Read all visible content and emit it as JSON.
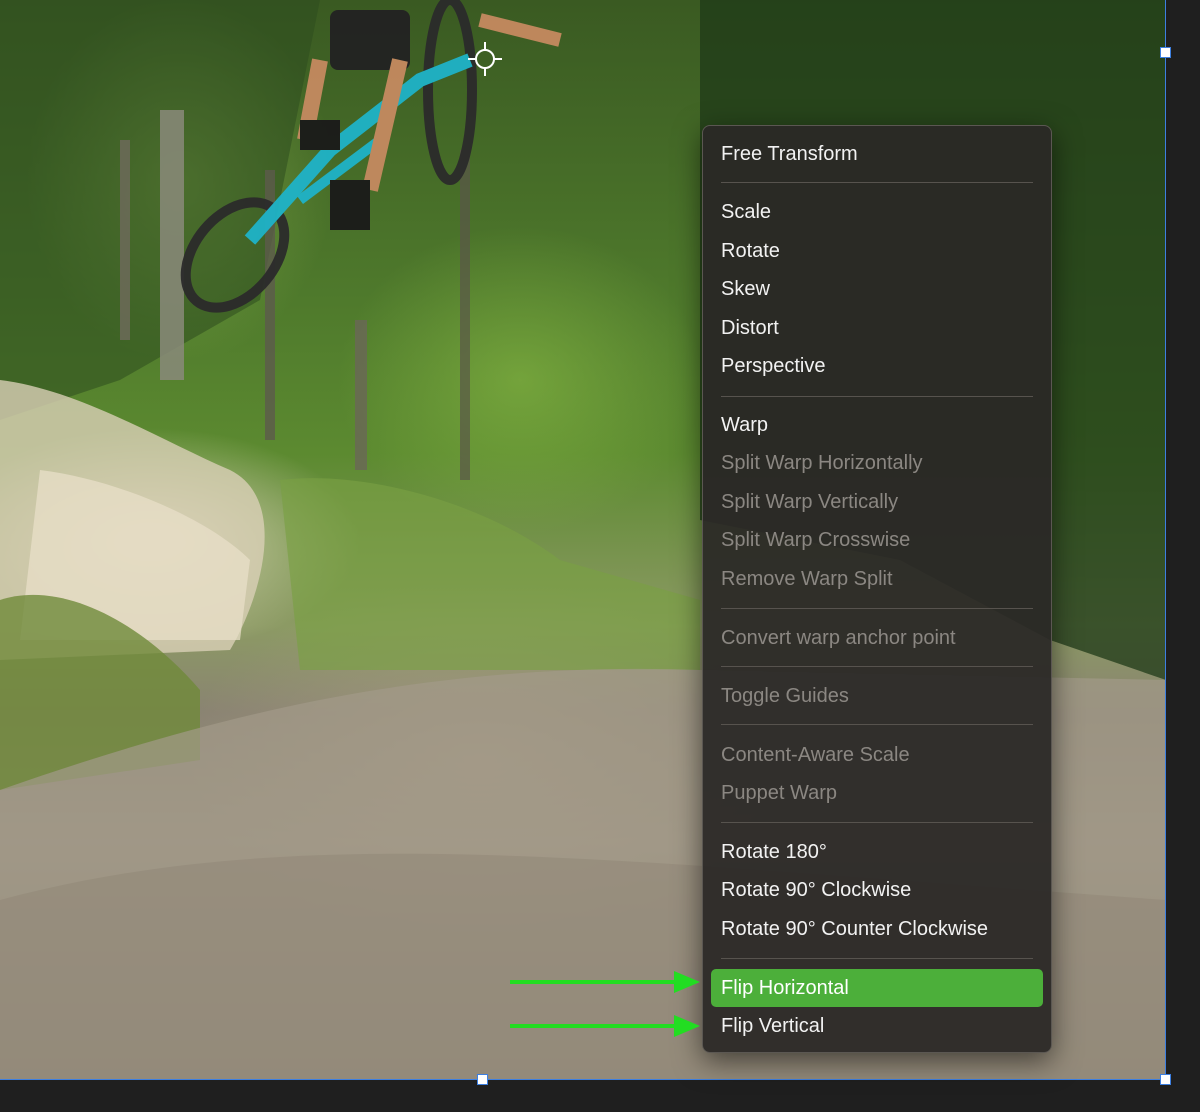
{
  "menu": {
    "items": [
      {
        "label": "Free Transform",
        "enabled": true
      },
      {
        "label": "Scale",
        "enabled": true
      },
      {
        "label": "Rotate",
        "enabled": true
      },
      {
        "label": "Skew",
        "enabled": true
      },
      {
        "label": "Distort",
        "enabled": true
      },
      {
        "label": "Perspective",
        "enabled": true
      },
      {
        "label": "Warp",
        "enabled": true
      },
      {
        "label": "Split Warp Horizontally",
        "enabled": false
      },
      {
        "label": "Split Warp Vertically",
        "enabled": false
      },
      {
        "label": "Split Warp Crosswise",
        "enabled": false
      },
      {
        "label": "Remove Warp Split",
        "enabled": false
      },
      {
        "label": "Convert warp anchor point",
        "enabled": false
      },
      {
        "label": "Toggle Guides",
        "enabled": false
      },
      {
        "label": "Content-Aware Scale",
        "enabled": false
      },
      {
        "label": "Puppet Warp",
        "enabled": false
      },
      {
        "label": "Rotate 180°",
        "enabled": true
      },
      {
        "label": "Rotate 90° Clockwise",
        "enabled": true
      },
      {
        "label": "Rotate 90° Counter Clockwise",
        "enabled": true
      },
      {
        "label": "Flip Horizontal",
        "enabled": true,
        "highlighted": true
      },
      {
        "label": "Flip Vertical",
        "enabled": true
      }
    ]
  },
  "colors": {
    "highlight": "#4caf3a",
    "annotation_arrow": "#22dd22",
    "transform_frame": "#3d7fe0",
    "menu_background": "#2a2826",
    "menu_text": "#f2f2f2",
    "menu_text_disabled": "#8b8782"
  },
  "icons": {
    "canvas_target": "crosshair-icon",
    "annotation": "arrow-right-icon"
  }
}
